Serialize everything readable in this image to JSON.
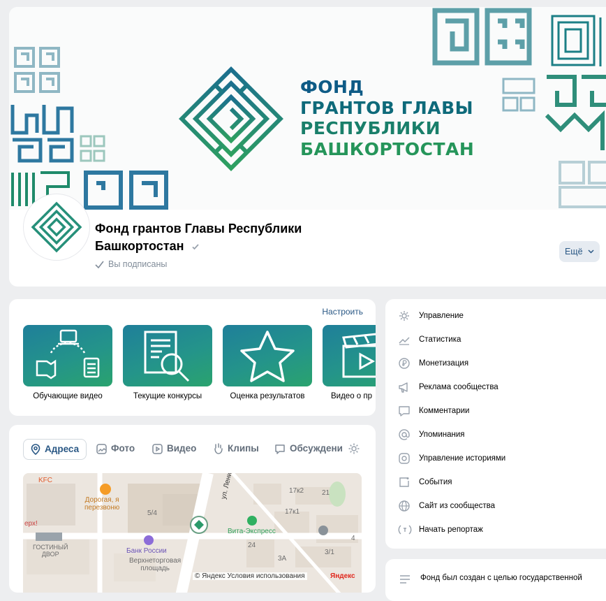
{
  "header": {
    "cover_title_lines": [
      "ФОНД",
      "ГРАНТОВ ГЛАВЫ",
      "РЕСПУБЛИКИ",
      "БАШКОРТОСТАН"
    ],
    "group_name": "Фонд грантов Главы Республики Башкортостан",
    "subscribed_label": "Вы подписаны",
    "more_button_label": "Ещё"
  },
  "shortcuts": {
    "customize_label": "Настроить",
    "items": [
      {
        "label": "Обучающие видео",
        "icon": "education-video-icon"
      },
      {
        "label": "Текущие конкурсы",
        "icon": "document-search-icon"
      },
      {
        "label": "Оценка результатов",
        "icon": "star-icon"
      },
      {
        "label": "Видео о пр",
        "icon": "clapperboard-icon"
      }
    ]
  },
  "tabs": {
    "items": [
      {
        "label": "Адреса",
        "icon": "location-pin-icon"
      },
      {
        "label": "Фото",
        "icon": "photo-icon"
      },
      {
        "label": "Видео",
        "icon": "video-icon"
      },
      {
        "label": "Клипы",
        "icon": "clips-icon"
      },
      {
        "label": "Обсуждени",
        "icon": "discussion-icon"
      }
    ],
    "active": "Адреса"
  },
  "map": {
    "labels": {
      "kfc": "KFC",
      "cafe": "Дорогая, я\nперезвоню",
      "num_5_4": "5/4",
      "gostiny": "ГОСТИНЫЙ\nДВОР",
      "bank": "Банк России",
      "square": "Верхнеторговая\nплощадь",
      "street": "ул. Ленина",
      "vita": "Вита-Экспресс",
      "num_17x2": "17к2",
      "num_21": "21",
      "num_17k1": "17к1",
      "num_24": "24",
      "num_3a": "3А",
      "num_3_1": "3/1",
      "num_4": "4",
      "erx": "ерх!",
      "copyright": "© Яндекс Условия использования",
      "brand": "Яндекс"
    }
  },
  "management": {
    "items": [
      {
        "label": "Управление",
        "icon": "gear-icon"
      },
      {
        "label": "Статистика",
        "icon": "stats-icon"
      },
      {
        "label": "Монетизация",
        "icon": "coin-icon"
      },
      {
        "label": "Реклама сообщества",
        "icon": "megaphone-icon"
      },
      {
        "label": "Комментарии",
        "icon": "comment-icon"
      },
      {
        "label": "Упоминания",
        "icon": "mention-icon"
      },
      {
        "label": "Управление историями",
        "icon": "stories-icon"
      },
      {
        "label": "События",
        "icon": "event-icon"
      },
      {
        "label": "Сайт из сообщества",
        "icon": "globe-icon"
      },
      {
        "label": "Начать репортаж",
        "icon": "broadcast-icon"
      }
    ]
  },
  "description": {
    "text": "Фонд был создан с целью государственной"
  },
  "colors": {
    "brand_teal": "#1f8a8a",
    "brand_green": "#2aa36e",
    "link_blue": "#2a5885",
    "muted": "#818c99"
  }
}
